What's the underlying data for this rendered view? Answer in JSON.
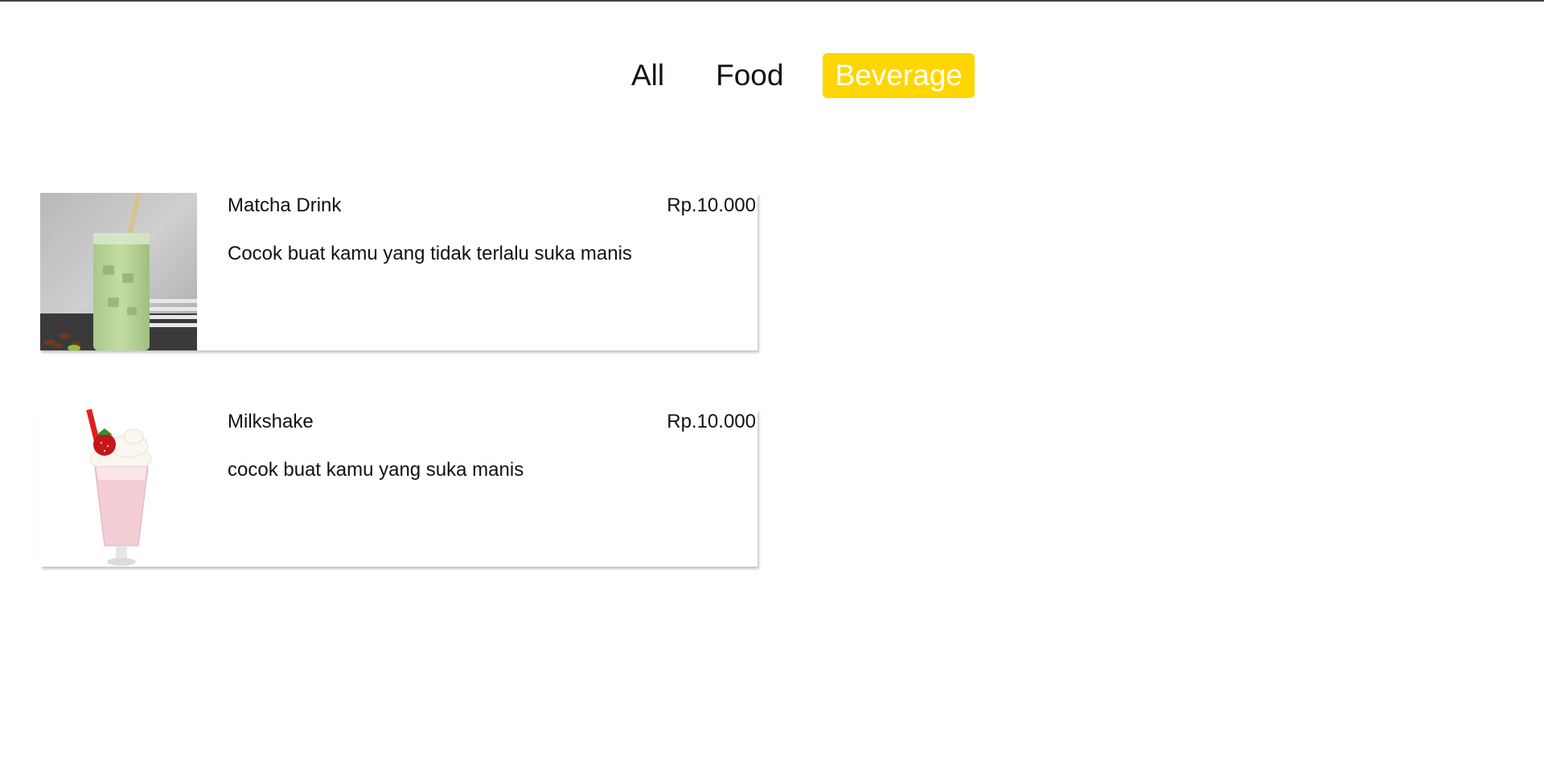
{
  "filters": {
    "all_label": "All",
    "food_label": "Food",
    "beverage_label": "Beverage",
    "active": "Beverage",
    "active_color": "#ffd600"
  },
  "menu_items": [
    {
      "name": "Matcha Drink",
      "price": "Rp.10.000",
      "description": "Cocok buat kamu yang tidak terlalu suka manis",
      "image_icon": "matcha-drink-image"
    },
    {
      "name": "Milkshake",
      "price": "Rp.10.000",
      "description": "cocok buat kamu yang suka manis",
      "image_icon": "milkshake-image"
    }
  ]
}
